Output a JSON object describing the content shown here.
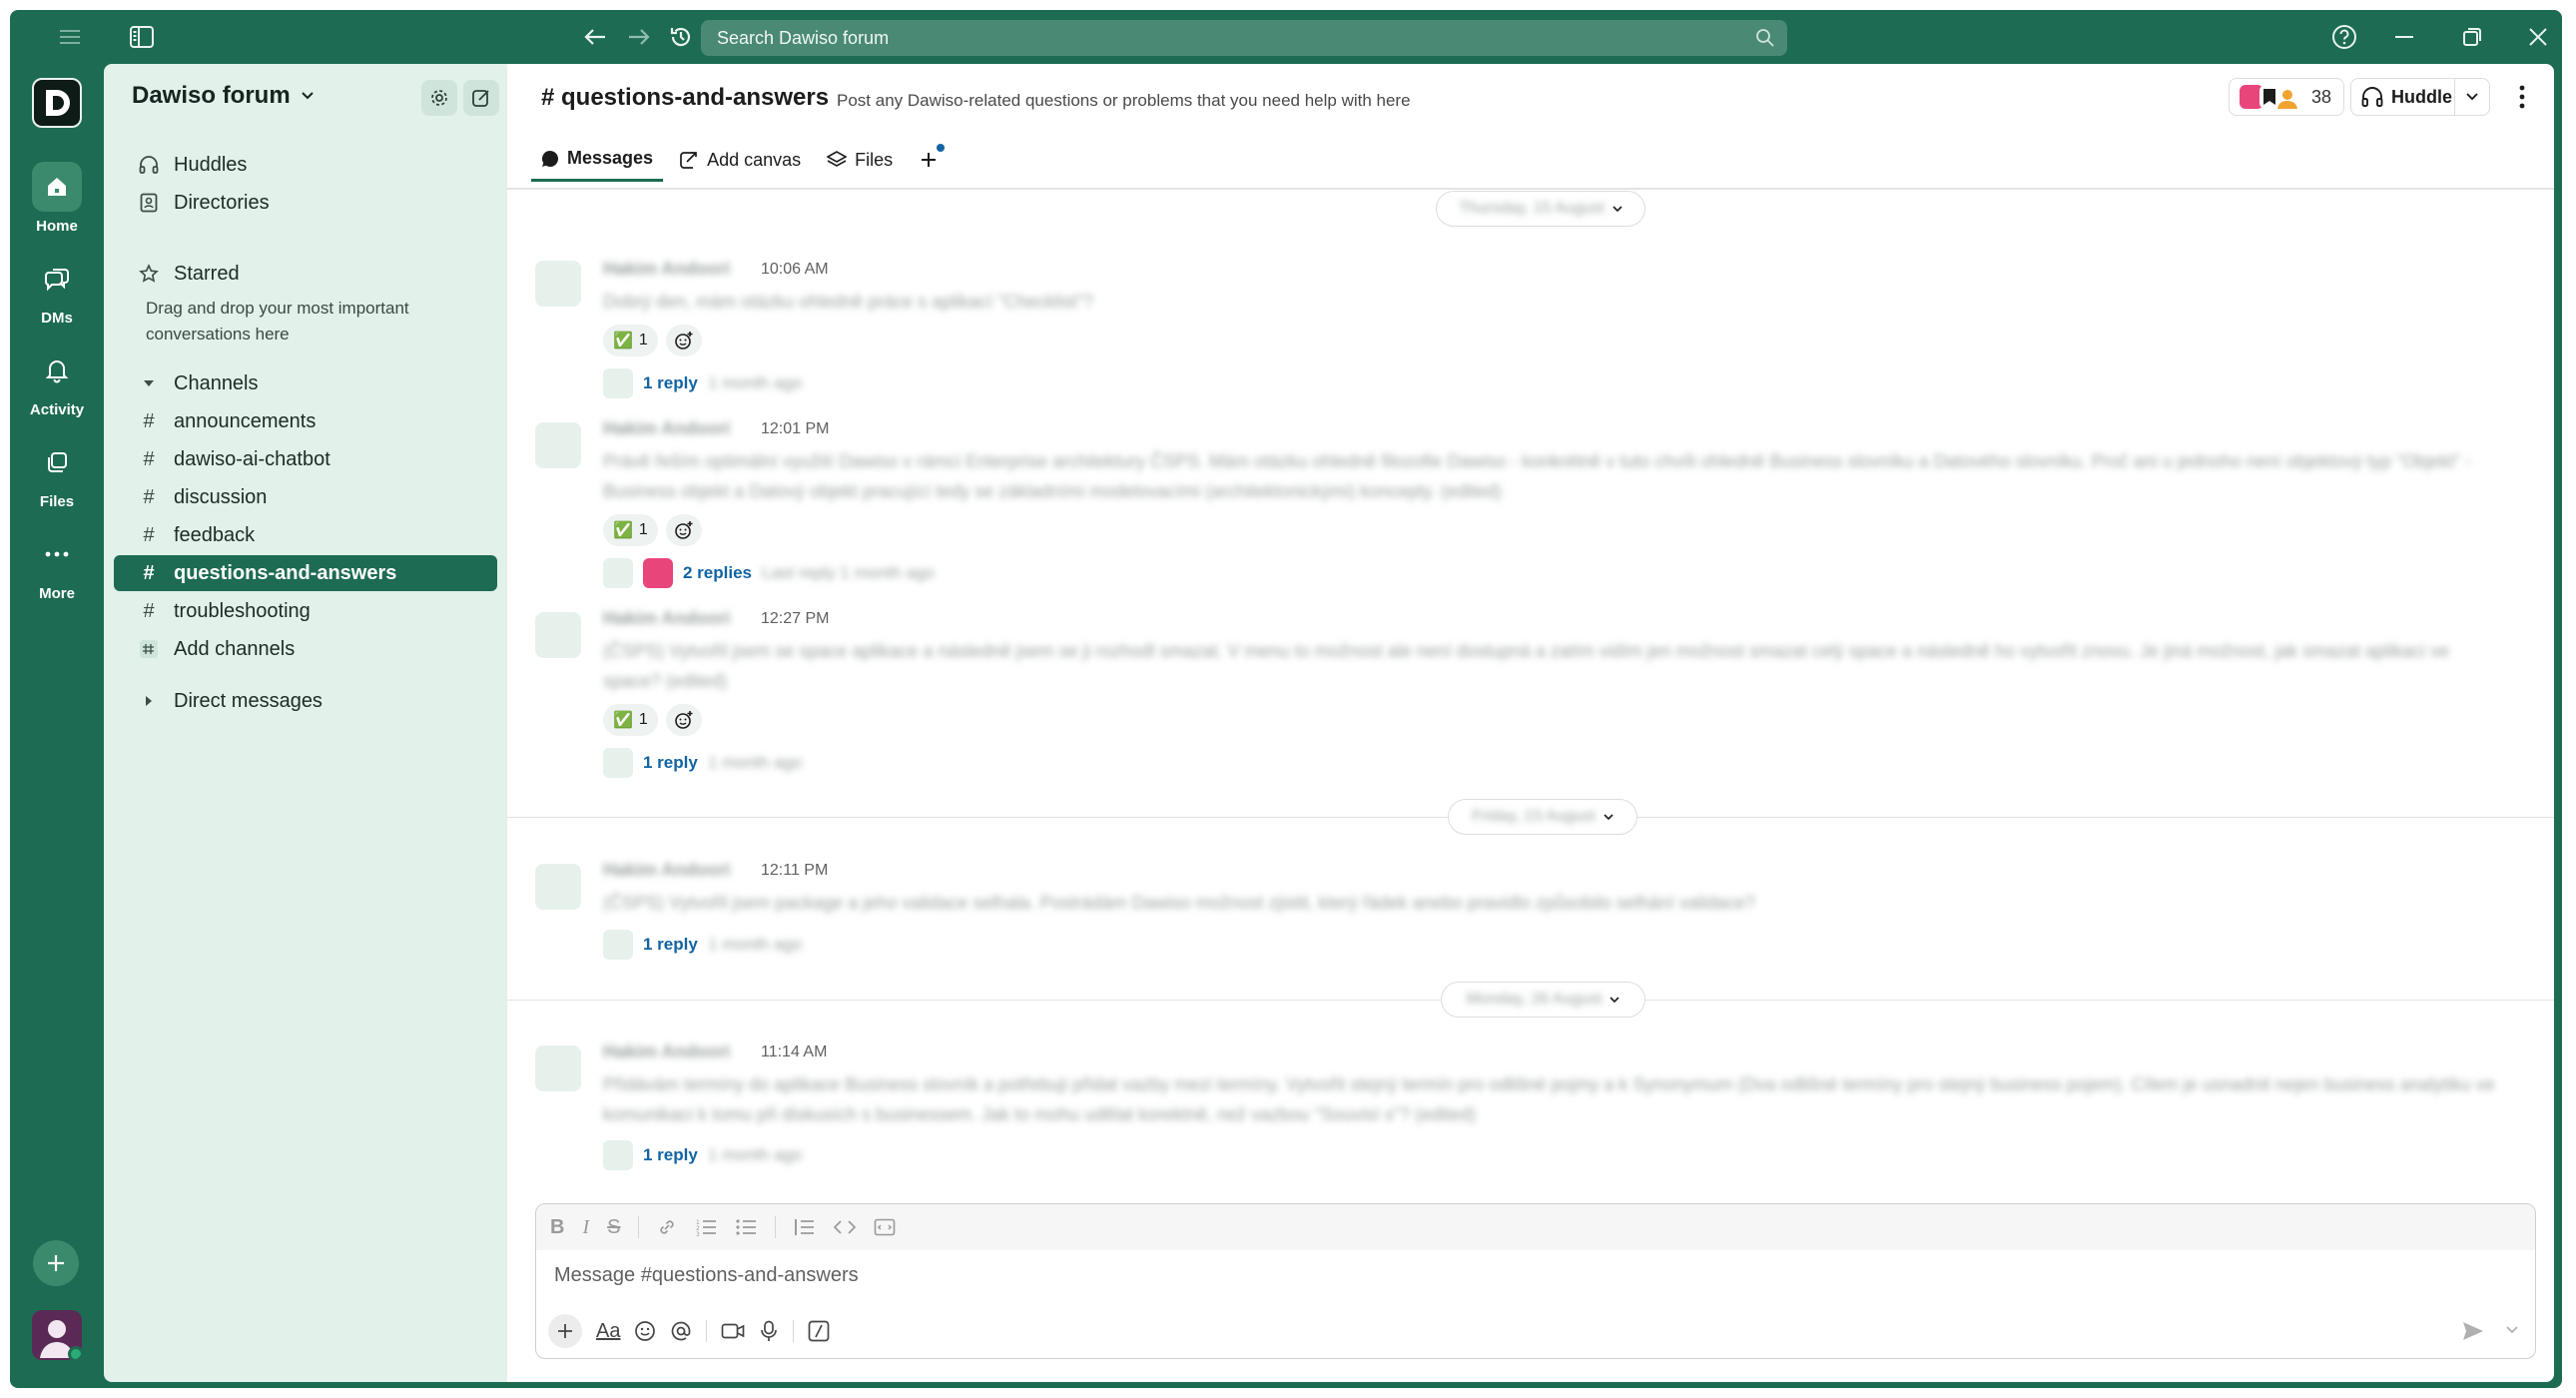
{
  "titlebar": {
    "search_placeholder": "Search Dawiso forum"
  },
  "rail": {
    "items": [
      {
        "label": "Home",
        "icon": "home-icon"
      },
      {
        "label": "DMs",
        "icon": "dms-icon"
      },
      {
        "label": "Activity",
        "icon": "bell-icon"
      },
      {
        "label": "Files",
        "icon": "files-icon"
      },
      {
        "label": "More",
        "icon": "more-icon"
      }
    ]
  },
  "sidebar": {
    "workspace": "Dawiso forum",
    "top_items": [
      {
        "label": "Huddles",
        "icon": "headphones-icon"
      },
      {
        "label": "Directories",
        "icon": "directory-icon"
      }
    ],
    "starred_label": "Starred",
    "starred_hint": "Drag and drop your most important conversations here",
    "channels_label": "Channels",
    "channels": [
      {
        "name": "announcements",
        "active": false
      },
      {
        "name": "dawiso-ai-chatbot",
        "active": false
      },
      {
        "name": "discussion",
        "active": false
      },
      {
        "name": "feedback",
        "active": false
      },
      {
        "name": "questions-and-answers",
        "active": true
      },
      {
        "name": "troubleshooting",
        "active": false
      }
    ],
    "add_channels": "Add channels",
    "direct_messages_label": "Direct messages"
  },
  "channel": {
    "title": "# questions-and-answers",
    "description": "Post any Dawiso-related questions or problems that you need help with here",
    "member_count": "38",
    "huddle_label": "Huddle",
    "tabs": [
      {
        "label": "Messages",
        "active": true
      },
      {
        "label": "Add canvas",
        "active": false
      },
      {
        "label": "Files",
        "active": false
      }
    ]
  },
  "day_dividers": [
    "Thursday, 15 August",
    "Friday, 23 August",
    "Monday, 26 August"
  ],
  "messages": [
    {
      "author": "Hakim Andoori",
      "time": "10:06 AM",
      "text": "Dobrý den, mám otázku ohledně práce s aplikací \"Checklist\"?",
      "reaction": {
        "emoji": "✅",
        "count": "1"
      },
      "thread": {
        "label": "1 reply",
        "meta": "1 month ago"
      }
    },
    {
      "author": "Hakim Andoori",
      "time": "12:01 PM",
      "text": "Právě řeším optimální využití Dawiso v rámci Enterprise architektury ČSPS. Mám otázku ohledně filozofie Dawiso - konkrétně v tuto chvíli ohledně Business slovníku a Datového slovníku. Proč ani u jednoho není objektový typ \"Objekt\" - Business objekt a Datový objekt pracující tedy se základními modelovacími (architektonickými) koncepty. (edited)",
      "reaction": {
        "emoji": "✅",
        "count": "1"
      },
      "thread": {
        "label": "2 replies",
        "meta": "Last reply 1 month ago"
      }
    },
    {
      "author": "Hakim Andoori",
      "time": "12:27 PM",
      "text": "(ČSPS) Vytvořil jsem se space aplikace a následně jsem se ji rozhodl smazat. V menu to možnost ale není dostupná a zatím vidím jen možnost smazat celý space a následně ho vytvořit znovu. Je jiná možnost, jak smazat aplikaci ve space? (edited)",
      "reaction": {
        "emoji": "✅",
        "count": "1"
      },
      "thread": {
        "label": "1 reply",
        "meta": "1 month ago"
      }
    },
    {
      "author": "Hakim Andoori",
      "time": "12:11 PM",
      "text": "(ČSPS) Vytvořil jsem package a jeho validace selhala. Postrádám Dawiso možnost zjistit, který řádek anebo pravidlo způsobilo selhání validace?",
      "thread": {
        "label": "1 reply",
        "meta": "1 month ago"
      }
    },
    {
      "author": "Hakim Andoori",
      "time": "11:14 AM",
      "text": "Přidávám termíny do aplikace Business slovník a potřebuji přidat vazby mezi termíny. Vytvořit stejný termín pro odlišné pojmy a k Synonymum (Dva odlišné termíny pro stejný business pojem). Cílem je usnadnit nejen business analytiku ve komunikaci k tomu při diskusích s businessem. Jak to mohu udělat korektně, než vazbou \"Souvisí s\"? (edited)",
      "thread": {
        "label": "1 reply",
        "meta": "1 month ago"
      }
    }
  ],
  "composer": {
    "placeholder": "Message #questions-and-answers",
    "font_button": "Aa"
  }
}
